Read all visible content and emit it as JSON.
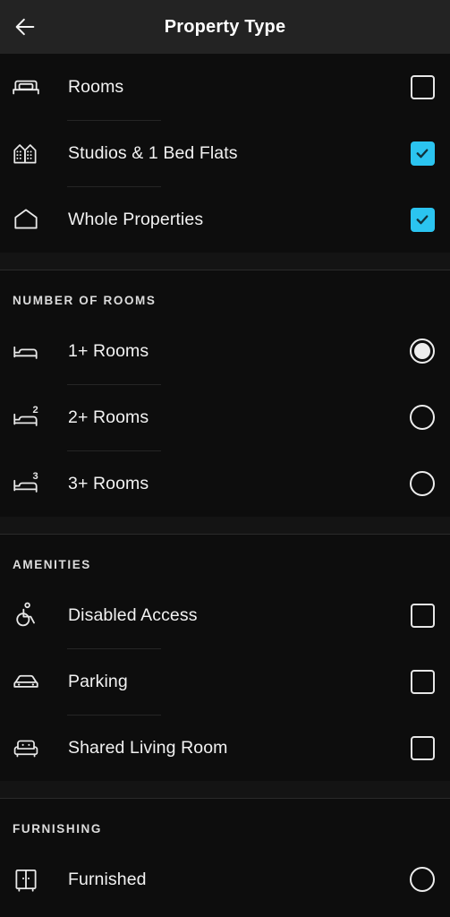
{
  "header": {
    "title": "Property Type",
    "back_icon": "arrow-left-icon"
  },
  "sections": [
    {
      "id": "property-type",
      "title": "",
      "rows": [
        {
          "label": "Rooms",
          "icon": "bed-icon",
          "control": "checkbox",
          "checked": false
        },
        {
          "label": "Studios & 1 Bed Flats",
          "icon": "buildings-icon",
          "control": "checkbox",
          "checked": true
        },
        {
          "label": "Whole Properties",
          "icon": "house-icon",
          "control": "checkbox",
          "checked": true
        }
      ]
    },
    {
      "id": "number-of-rooms",
      "title": "NUMBER OF ROOMS",
      "rows": [
        {
          "label": "1+ Rooms",
          "icon": "bed-single-icon",
          "badge": "",
          "control": "radio",
          "checked": true
        },
        {
          "label": "2+ Rooms",
          "icon": "bed-two-icon",
          "badge": "2",
          "control": "radio",
          "checked": false
        },
        {
          "label": "3+ Rooms",
          "icon": "bed-three-icon",
          "badge": "3",
          "control": "radio",
          "checked": false
        }
      ]
    },
    {
      "id": "amenities",
      "title": "AMENITIES",
      "rows": [
        {
          "label": "Disabled Access",
          "icon": "wheelchair-icon",
          "control": "checkbox",
          "checked": false
        },
        {
          "label": "Parking",
          "icon": "car-icon",
          "control": "checkbox",
          "checked": false
        },
        {
          "label": "Shared Living Room",
          "icon": "sofa-icon",
          "control": "checkbox",
          "checked": false
        }
      ]
    },
    {
      "id": "furnishing",
      "title": "FURNISHING",
      "rows": [
        {
          "label": "Furnished",
          "icon": "wardrobe-icon",
          "control": "radio",
          "checked": false
        }
      ]
    }
  ],
  "colors": {
    "accent": "#2bc4f0",
    "background": "#0d0d0d",
    "appbar": "#232323",
    "text": "#f2f2f2",
    "divider": "#252525"
  }
}
